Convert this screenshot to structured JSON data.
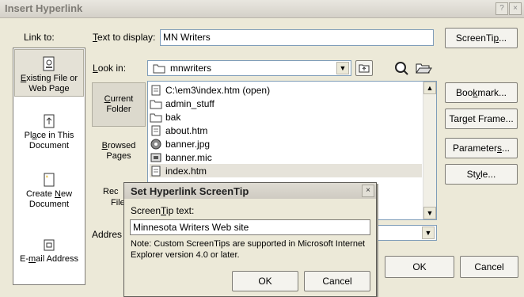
{
  "window": {
    "title": "Insert Hyperlink",
    "help_glyph": "?",
    "close_glyph": "×"
  },
  "linkto": {
    "label": "Link to:",
    "items": [
      {
        "prefix": "",
        "accel": "E",
        "rest": "xisting File or Web Page"
      },
      {
        "prefix": "Pl",
        "accel": "a",
        "rest": "ce in This Document"
      },
      {
        "prefix": "Create ",
        "accel": "N",
        "rest": "ew Document"
      },
      {
        "prefix": "E-",
        "accel": "m",
        "rest": "ail Address"
      }
    ]
  },
  "text_display": {
    "accel": "T",
    "label_rest": "ext to display:",
    "value": "MN Writers"
  },
  "screentip_btn": {
    "prefix": "ScreenTi",
    "accel": "p",
    "suffix": "..."
  },
  "look_in": {
    "accel": "L",
    "label_rest": "ook in:",
    "value": "mnwriters"
  },
  "subnav": {
    "current": {
      "accel": "C",
      "rest": "urrent Folder"
    },
    "browsed": {
      "accel": "B",
      "rest": "rowsed Pages"
    },
    "recent_partial": "Rec",
    "recent_partial2": "File"
  },
  "files": [
    {
      "name": "C:\\em3\\index.htm (open)",
      "icon": "htm-file-icon"
    },
    {
      "name": "admin_stuff",
      "icon": "folder-icon"
    },
    {
      "name": "bak",
      "icon": "folder-icon"
    },
    {
      "name": "about.htm",
      "icon": "htm-file-icon"
    },
    {
      "name": "banner.jpg",
      "icon": "image-file-icon"
    },
    {
      "name": "banner.mic",
      "icon": "mic-file-icon"
    },
    {
      "name": "index.htm",
      "icon": "htm-file-icon"
    }
  ],
  "address": {
    "label": "Addres"
  },
  "right_buttons": [
    {
      "prefix": "Boo",
      "accel": "k",
      "suffix": "mark..."
    },
    {
      "prefix": "Tar",
      "accel": "g",
      "suffix": "et Frame..."
    },
    {
      "prefix": "Parameter",
      "accel": "s",
      "suffix": "..."
    },
    {
      "prefix": "St",
      "accel": "y",
      "suffix": "le..."
    }
  ],
  "main_ok": "OK",
  "main_cancel": "Cancel",
  "tip_dialog": {
    "title": "Set Hyperlink ScreenTip",
    "label_prefix": "Screen",
    "label_accel": "T",
    "label_rest": "ip text:",
    "value": "Minnesota Writers Web site",
    "note": "Note: Custom ScreenTips are supported in Microsoft Internet Explorer version 4.0 or later.",
    "ok": "OK",
    "cancel": "Cancel",
    "close_glyph": "×"
  }
}
